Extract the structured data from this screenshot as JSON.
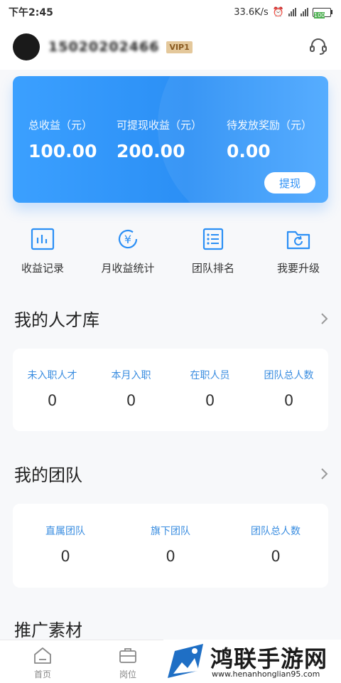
{
  "status_bar": {
    "time": "下午2:45",
    "net_speed": "33.6K/s",
    "battery": "100"
  },
  "profile": {
    "phone": "15020202466",
    "vip_badge": "VIP1"
  },
  "balance": {
    "total_label": "总收益（元）",
    "total_value": "100.00",
    "withdrawable_label": "可提现收益（元）",
    "withdrawable_value": "200.00",
    "pending_label": "待发放奖励（元）",
    "pending_value": "0.00",
    "withdraw_button": "提现"
  },
  "quick_nav": [
    {
      "label": "收益记录",
      "icon": "bar-chart-icon"
    },
    {
      "label": "月收益统计",
      "icon": "yuan-circle-icon"
    },
    {
      "label": "团队排名",
      "icon": "list-icon"
    },
    {
      "label": "我要升级",
      "icon": "folder-refresh-icon"
    }
  ],
  "talent": {
    "title": "我的人才库",
    "items": [
      {
        "label": "未入职人才",
        "value": "0"
      },
      {
        "label": "本月入职",
        "value": "0"
      },
      {
        "label": "在职人员",
        "value": "0"
      },
      {
        "label": "团队总人数",
        "value": "0"
      }
    ]
  },
  "team": {
    "title": "我的团队",
    "items": [
      {
        "label": "直属团队",
        "value": "0"
      },
      {
        "label": "旗下团队",
        "value": "0"
      },
      {
        "label": "团队总人数",
        "value": "0"
      }
    ]
  },
  "promo": {
    "title": "推广素材"
  },
  "tabs": [
    {
      "label": "首页",
      "icon": "home-icon"
    },
    {
      "label": "岗位",
      "icon": "briefcase-icon"
    }
  ],
  "watermark": {
    "title": "鸿联手游网",
    "url": "www.henanhonglian95.com"
  },
  "colors": {
    "accent": "#2b8ff5",
    "label_blue": "#3a8de0"
  }
}
